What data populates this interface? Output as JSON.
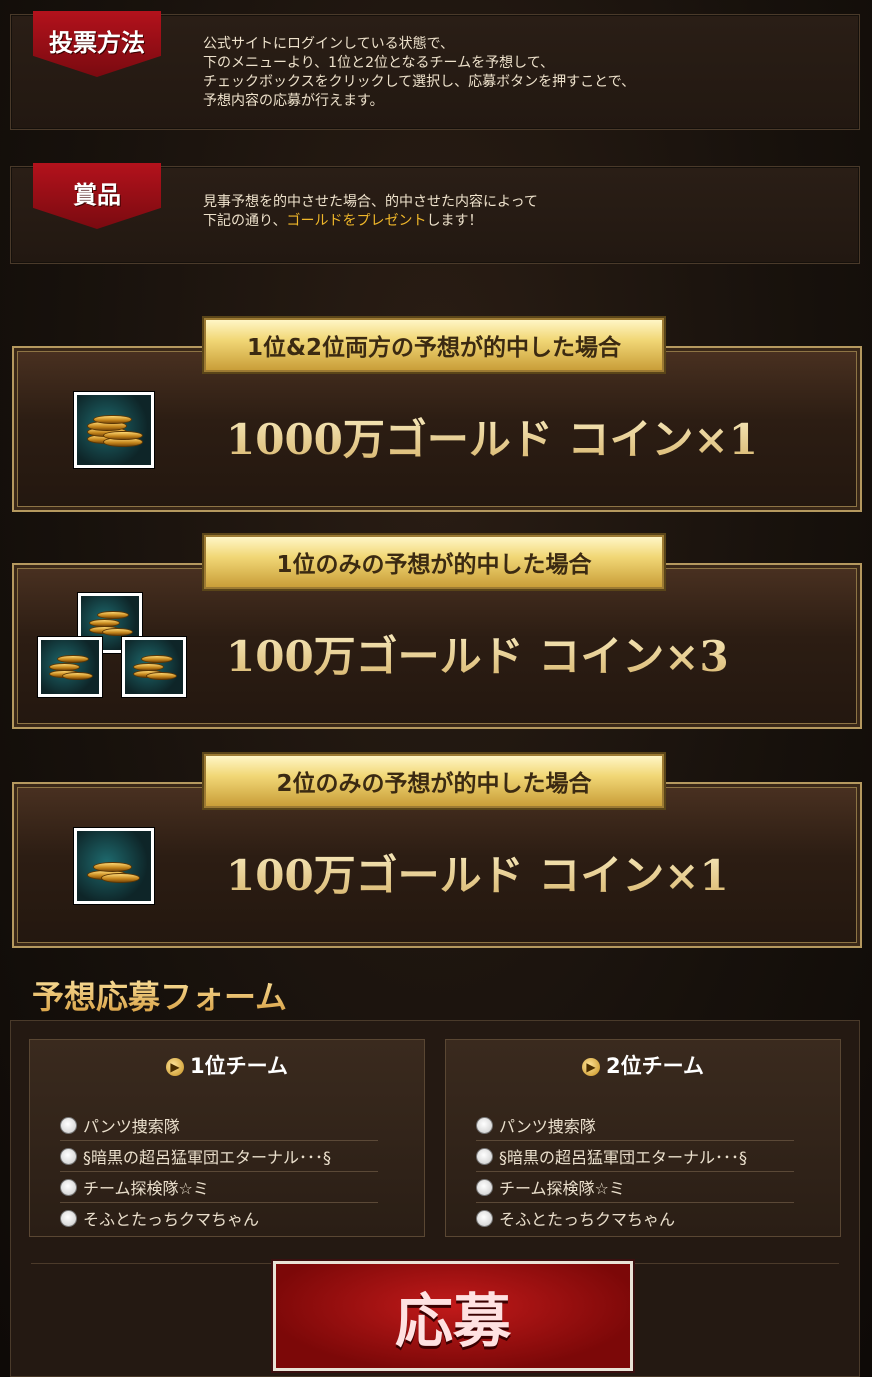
{
  "voting": {
    "ribbon": "投票方法",
    "text": "公式サイトにログインしている状態で、\n下のメニューより、1位と2位となるチームを予想して、\nチェックボックスをクリックして選択し、応募ボタンを押すことで、\n予想内容の応募が行えます。"
  },
  "prize": {
    "ribbon": "賞品",
    "text_line1": "見事予想を的中させた場合、的中させた内容によって",
    "text_line2_pre": "下記の通り、",
    "text_line2_highlight": "ゴールドをプレゼント",
    "text_line2_post": "します！",
    "highlight_color": "#f0b72a"
  },
  "rewards": [
    {
      "title": "1位&2位両方の予想が的中した場合",
      "amount": "1000万ゴールド コイン×1",
      "icon": "gold-coin-stack-icon"
    },
    {
      "title": "1位のみの予想が的中した場合",
      "amount": "100万ゴールド コイン×3",
      "icon": "gold-coin-stack-icon"
    },
    {
      "title": "2位のみの予想が的中した場合",
      "amount": "100万ゴールド コイン×1",
      "icon": "gold-coin-stack-icon"
    }
  ],
  "form": {
    "title": "予想応募フォーム",
    "first": {
      "label": "1位チーム",
      "options": [
        "パンツ捜索隊",
        "§暗黒の超呂猛軍団エターナル･･･§",
        "チーム探検隊☆ミ",
        "そふとたっちクマちゃん"
      ]
    },
    "second": {
      "label": "2位チーム",
      "options": [
        "パンツ捜索隊",
        "§暗黒の超呂猛軍団エターナル･･･§",
        "チーム探検隊☆ミ",
        "そふとたっちクマちゃん"
      ]
    },
    "submit_label": "応募"
  }
}
